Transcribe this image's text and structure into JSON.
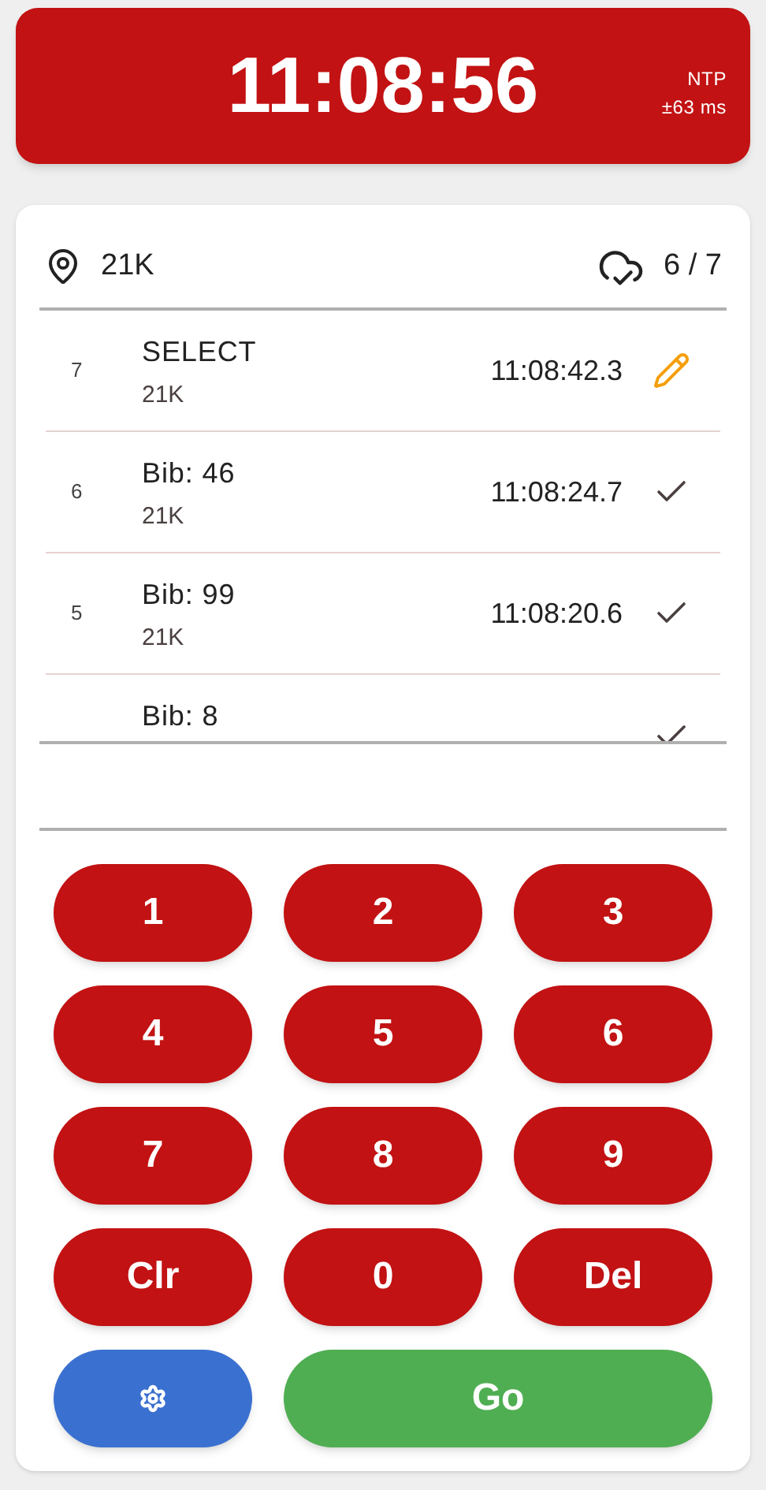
{
  "clock": {
    "time": "11:08:56",
    "source": "NTP",
    "offset": "±63 ms"
  },
  "header": {
    "location": "21K",
    "sync_count": "6 / 7"
  },
  "entries": [
    {
      "index": "7",
      "title": "SELECT",
      "subtitle": "21K",
      "time": "11:08:42.3",
      "synced": false
    },
    {
      "index": "6",
      "title": "Bib: 46",
      "subtitle": "21K",
      "time": "11:08:24.7",
      "synced": true
    },
    {
      "index": "5",
      "title": "Bib: 99",
      "subtitle": "21K",
      "time": "11:08:20.6",
      "synced": true
    },
    {
      "title": "Bib: 8",
      "synced": true
    }
  ],
  "keypad": [
    "1",
    "2",
    "3",
    "4",
    "5",
    "6",
    "7",
    "8",
    "9",
    "Clr",
    "0",
    "Del"
  ],
  "go_button": "Go"
}
